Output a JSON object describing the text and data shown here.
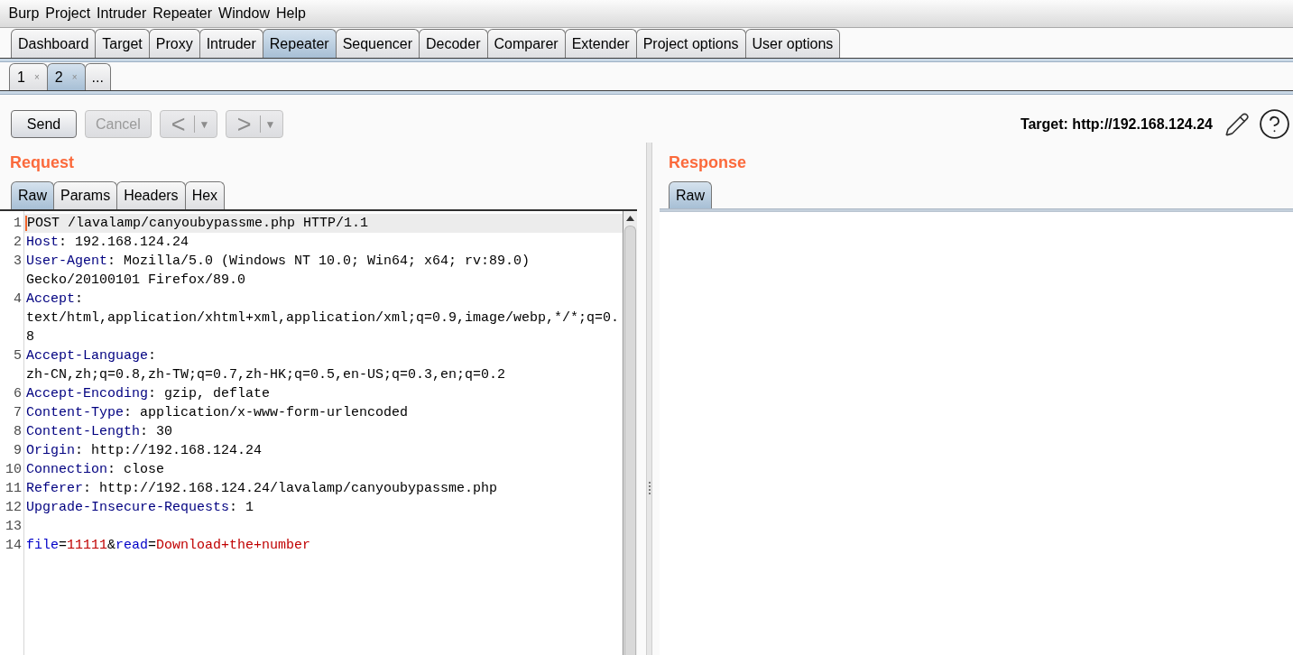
{
  "menu_bar": [
    "Burp",
    "Project",
    "Intruder",
    "Repeater",
    "Window",
    "Help"
  ],
  "main_tabs": [
    {
      "label": "Dashboard",
      "selected": false
    },
    {
      "label": "Target",
      "selected": false
    },
    {
      "label": "Proxy",
      "selected": false
    },
    {
      "label": "Intruder",
      "selected": false
    },
    {
      "label": "Repeater",
      "selected": true
    },
    {
      "label": "Sequencer",
      "selected": false
    },
    {
      "label": "Decoder",
      "selected": false
    },
    {
      "label": "Comparer",
      "selected": false
    },
    {
      "label": "Extender",
      "selected": false
    },
    {
      "label": "Project options",
      "selected": false
    },
    {
      "label": "User options",
      "selected": false
    }
  ],
  "repeater_tabs": [
    {
      "kind": "request",
      "label": "1",
      "close": "×",
      "selected": false
    },
    {
      "kind": "request",
      "label": "2",
      "close": "×",
      "selected": true
    },
    {
      "kind": "new",
      "label": "...",
      "selected": false
    }
  ],
  "toolbar": {
    "buttons": [
      {
        "kind": "send",
        "label": "Send",
        "disabled": false
      },
      {
        "kind": "cancel",
        "label": "Cancel",
        "disabled": true
      },
      {
        "kind": "back",
        "label": "<",
        "menu": "▼",
        "disabled": true
      },
      {
        "kind": "forward",
        "label": ">",
        "menu": "▼",
        "disabled": true
      }
    ],
    "target": "Target: http://192.168.124.24"
  },
  "request": {
    "title": "Request",
    "tabs": [
      {
        "label": "Raw",
        "selected": true
      },
      {
        "label": "Params",
        "selected": false
      },
      {
        "label": "Headers",
        "selected": false
      },
      {
        "label": "Hex",
        "selected": false
      }
    ],
    "lines": [
      {
        "number": "1",
        "current": true,
        "rows": [
          [
            {
              "kind": "plain",
              "text": "POST /lavalamp/canyoubypassme.php HTTP/1.1"
            }
          ]
        ]
      },
      {
        "number": "2",
        "current": false,
        "rows": [
          [
            {
              "kind": "header",
              "text": "Host"
            },
            {
              "kind": "plain",
              "text": ": 192.168.124.24"
            }
          ]
        ]
      },
      {
        "number": "3",
        "current": false,
        "rows": [
          [
            {
              "kind": "header",
              "text": "User-Agent"
            },
            {
              "kind": "plain",
              "text": ": Mozilla/5.0 (Windows NT 10.0; Win64; x64; rv:89.0)"
            }
          ],
          [
            {
              "kind": "plain",
              "text": "Gecko/20100101 Firefox/89.0"
            }
          ]
        ]
      },
      {
        "number": "4",
        "current": false,
        "rows": [
          [
            {
              "kind": "header",
              "text": "Accept"
            },
            {
              "kind": "plain",
              "text": ":"
            }
          ],
          [
            {
              "kind": "plain",
              "text": "text/html,application/xhtml+xml,application/xml;q=0.9,image/webp,*/*;q=0."
            }
          ],
          [
            {
              "kind": "plain",
              "text": "8"
            }
          ]
        ]
      },
      {
        "number": "5",
        "current": false,
        "rows": [
          [
            {
              "kind": "header",
              "text": "Accept-Language"
            },
            {
              "kind": "plain",
              "text": ":"
            }
          ],
          [
            {
              "kind": "plain",
              "text": "zh-CN,zh;q=0.8,zh-TW;q=0.7,zh-HK;q=0.5,en-US;q=0.3,en;q=0.2"
            }
          ]
        ]
      },
      {
        "number": "6",
        "current": false,
        "rows": [
          [
            {
              "kind": "header",
              "text": "Accept-Encoding"
            },
            {
              "kind": "plain",
              "text": ": gzip, deflate"
            }
          ]
        ]
      },
      {
        "number": "7",
        "current": false,
        "rows": [
          [
            {
              "kind": "header",
              "text": "Content-Type"
            },
            {
              "kind": "plain",
              "text": ": application/x-www-form-urlencoded"
            }
          ]
        ]
      },
      {
        "number": "8",
        "current": false,
        "rows": [
          [
            {
              "kind": "header",
              "text": "Content-Length"
            },
            {
              "kind": "plain",
              "text": ": 30"
            }
          ]
        ]
      },
      {
        "number": "9",
        "current": false,
        "rows": [
          [
            {
              "kind": "header",
              "text": "Origin"
            },
            {
              "kind": "plain",
              "text": ": http://192.168.124.24"
            }
          ]
        ]
      },
      {
        "number": "10",
        "current": false,
        "rows": [
          [
            {
              "kind": "header",
              "text": "Connection"
            },
            {
              "kind": "plain",
              "text": ": close"
            }
          ]
        ]
      },
      {
        "number": "11",
        "current": false,
        "rows": [
          [
            {
              "kind": "header",
              "text": "Referer"
            },
            {
              "kind": "plain",
              "text": ": http://192.168.124.24/lavalamp/canyoubypassme.php"
            }
          ]
        ]
      },
      {
        "number": "12",
        "current": false,
        "rows": [
          [
            {
              "kind": "header",
              "text": "Upgrade-Insecure-Requests"
            },
            {
              "kind": "plain",
              "text": ": 1"
            }
          ]
        ]
      },
      {
        "number": "13",
        "current": false
      },
      {
        "number": "14",
        "current": false,
        "rows": [
          [
            {
              "kind": "param_name",
              "text": "file"
            },
            {
              "kind": "plain",
              "text": "="
            },
            {
              "kind": "param_value",
              "text": "11111"
            },
            {
              "kind": "plain",
              "text": "&"
            },
            {
              "kind": "param_name",
              "text": "read"
            },
            {
              "kind": "plain",
              "text": "="
            },
            {
              "kind": "param_value",
              "text": "Download+the+number"
            }
          ]
        ]
      }
    ]
  },
  "response": {
    "title": "Response",
    "tabs": [
      {
        "label": "Raw",
        "selected": true
      }
    ]
  }
}
